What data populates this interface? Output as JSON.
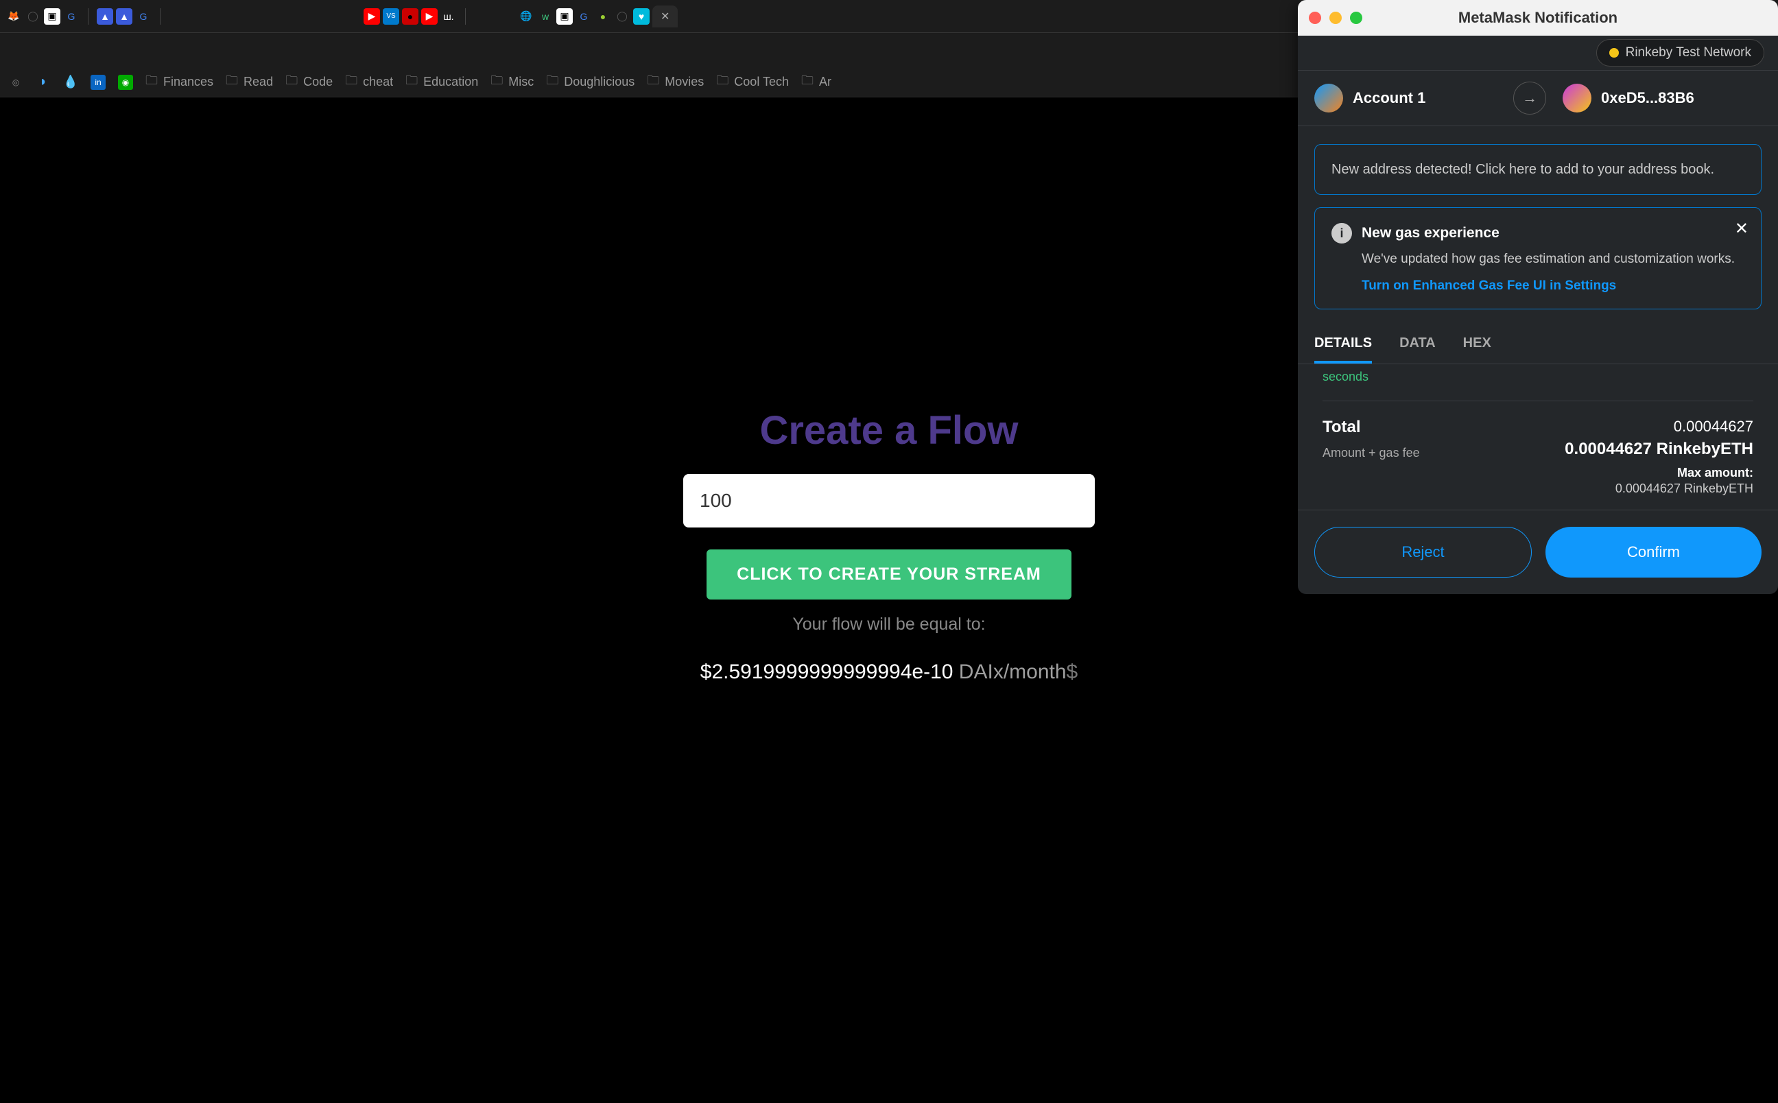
{
  "browser": {
    "tabs_favicons": [
      "🦊",
      "⚫",
      "⬜",
      "G",
      "",
      "🔷",
      "🔷",
      "G",
      "",
      "",
      "▶",
      "VS",
      "🟥",
      "▶",
      "ш.",
      "",
      "🌐",
      "w",
      "⬜",
      "G",
      "🟢",
      "⚫",
      "🟩"
    ],
    "active_tab_close": "✕",
    "url_actions": {
      "share": "⇪",
      "star": "☆"
    },
    "extensions": [
      "📊",
      "🛡",
      "💎"
    ]
  },
  "bookmarks": {
    "site_icons": [
      "🎯",
      "💧",
      "in",
      "🤖"
    ],
    "folders": [
      "Finances",
      "Read",
      "Code",
      "cheat",
      "Education",
      "Misc",
      "Doughlicious",
      "Movies",
      "Cool Tech",
      "Ar"
    ]
  },
  "page": {
    "title": "Create a Flow",
    "input_value": "100",
    "button": "CLICK TO CREATE YOUR STREAM",
    "equal_text": "Your flow will be equal to:",
    "amount_value": "$2.5919999999999994e-10",
    "amount_unit": " DAIx/month",
    "amount_suffix": "$"
  },
  "metamask": {
    "title": "MetaMask Notification",
    "network": "Rinkeby Test Network",
    "account_from": "Account 1",
    "account_to": "0xeD5...83B6",
    "address_notice": "New address detected! Click here to add to your address book.",
    "gas": {
      "title": "New gas experience",
      "desc": "We've updated how gas fee estimation and customization works.",
      "link": "Turn on Enhanced Gas Fee UI in Settings"
    },
    "tabs": {
      "details": "DETAILS",
      "data": "DATA",
      "hex": "HEX"
    },
    "seconds": "seconds",
    "total": {
      "label": "Total",
      "sub": "Amount + gas fee",
      "eth_small": "0.00044627",
      "eth_big": "0.00044627 RinkebyETH",
      "max_label": "Max amount:",
      "max_value": "0.00044627 RinkebyETH"
    },
    "actions": {
      "reject": "Reject",
      "confirm": "Confirm"
    }
  }
}
